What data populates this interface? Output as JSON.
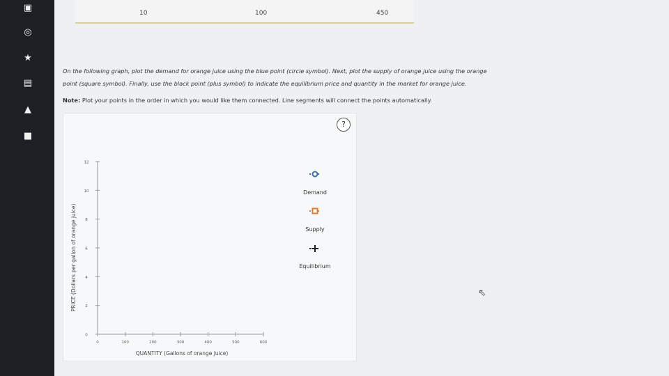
{
  "table": {
    "values": [
      "10",
      "100",
      "450"
    ]
  },
  "instructions": {
    "line1": "On the following graph, plot the demand for orange juice using the blue point (circle symbol). Next, plot the supply of orange juice using the orange",
    "line2": "point (square symbol). Finally, use the black point (plus symbol) to indicate the equilibrium price and quantity in the market for orange juice.",
    "note_label": "Note:",
    "note_text": " Plot your points in the order in which you would like them connected. Line segments will connect the points automatically."
  },
  "help": {
    "label": "?"
  },
  "chart_data": {
    "type": "scatter",
    "xlabel": "QUANTITY (Gallons of orange juice)",
    "ylabel": "PRICE (Dollars per gallon of orange juice)",
    "xlim": [
      0,
      600
    ],
    "ylim": [
      0,
      12
    ],
    "xticks": [
      0,
      100,
      200,
      300,
      400,
      500,
      600
    ],
    "yticks": [
      0,
      2,
      4,
      6,
      8,
      10,
      12
    ],
    "grid": false,
    "series": [
      {
        "name": "Demand",
        "symbol": "circle",
        "color": "#3a6fb0",
        "points": []
      },
      {
        "name": "Supply",
        "symbol": "square",
        "color": "#e07b2a",
        "points": []
      },
      {
        "name": "Equilibrium",
        "symbol": "plus",
        "color": "#222222",
        "points": []
      }
    ]
  },
  "legend": {
    "demand": "Demand",
    "supply": "Supply",
    "equilibrium": "Equilibrium"
  },
  "icons": [
    "notebook-icon",
    "compass-icon",
    "star-icon",
    "book-icon",
    "graduation-cap-icon",
    "briefcase-icon",
    "pointer-cursor-icon"
  ]
}
